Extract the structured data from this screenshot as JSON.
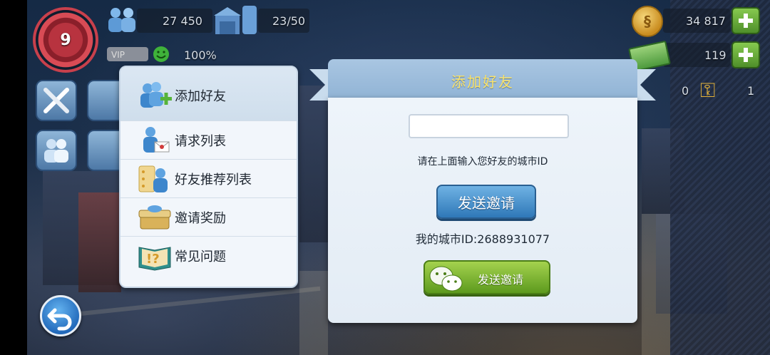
{
  "hud": {
    "level": "9",
    "population": "27 450",
    "vehicles": "23/50",
    "happiness": "100%",
    "simoleons": "34 817",
    "simcash": "119",
    "keys_silver": "0",
    "keys_gold": "1"
  },
  "menu": {
    "items": [
      {
        "label": "添加好友",
        "icon": "add-friend-icon"
      },
      {
        "label": "请求列表",
        "icon": "request-list-icon"
      },
      {
        "label": "好友推荐列表",
        "icon": "recommend-list-icon"
      },
      {
        "label": "邀请奖励",
        "icon": "invite-reward-icon"
      },
      {
        "label": "常见问题",
        "icon": "faq-icon"
      }
    ]
  },
  "dialog": {
    "title": "添加好友",
    "input_value": "",
    "hint": "请在上面输入您好友的城市ID",
    "send_button": "发送邀请",
    "my_city_id": "我的城市ID:2688931077",
    "wechat_button": "发送邀请"
  },
  "colors": {
    "title": "#fbe36a",
    "send_button": "#2f78b8",
    "wechat_button": "#5d9a1e",
    "level_badge": "#b8333f"
  }
}
